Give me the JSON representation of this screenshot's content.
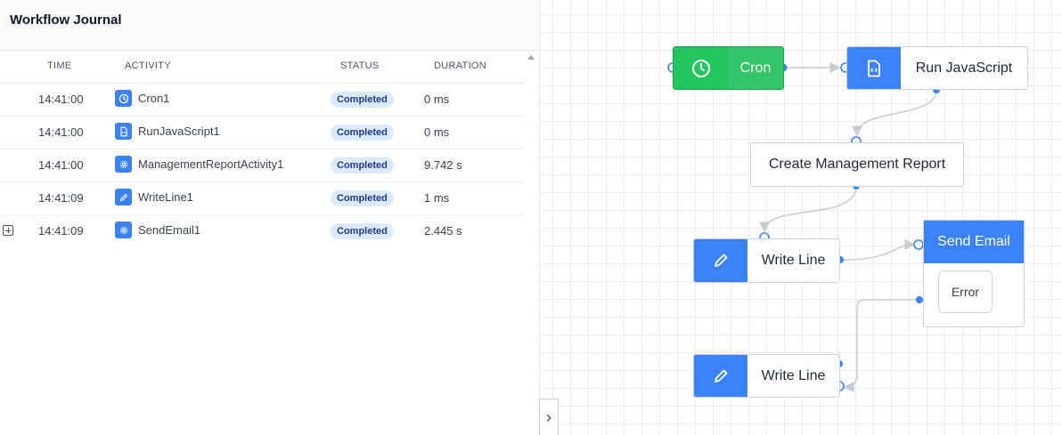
{
  "journal": {
    "title": "Workflow Journal",
    "columns": {
      "time": "TIME",
      "activity": "ACTIVITY",
      "status": "STATUS",
      "duration": "DURATION"
    },
    "rows": [
      {
        "time": "14:41:00",
        "activity": "Cron1",
        "icon": "clock-icon",
        "status": "Completed",
        "duration": "0 ms"
      },
      {
        "time": "14:41:00",
        "activity": "RunJavaScript1",
        "icon": "code-file-icon",
        "status": "Completed",
        "duration": "0 ms"
      },
      {
        "time": "14:41:00",
        "activity": "ManagementReportActivity1",
        "icon": "gear-icon",
        "status": "Completed",
        "duration": "9.742 s"
      },
      {
        "time": "14:41:09",
        "activity": "WriteLine1",
        "icon": "pencil-icon",
        "status": "Completed",
        "duration": "1 ms"
      },
      {
        "time": "14:41:09",
        "activity": "SendEmail1",
        "icon": "gear-icon",
        "status": "Completed",
        "duration": "2.445 s"
      }
    ]
  },
  "designer": {
    "nodes": {
      "cron": "Cron",
      "run_js": "Run JavaScript",
      "report": "Create Management Report",
      "write_line_1": "Write Line",
      "send_email": "Send Email",
      "error_outcome": "Error",
      "write_line_2": "Write Line"
    },
    "toggle_glyph": "›"
  },
  "colors": {
    "accent": "#3b82f6",
    "cron": "#22c55e",
    "badge_bg": "#dbeafe"
  }
}
